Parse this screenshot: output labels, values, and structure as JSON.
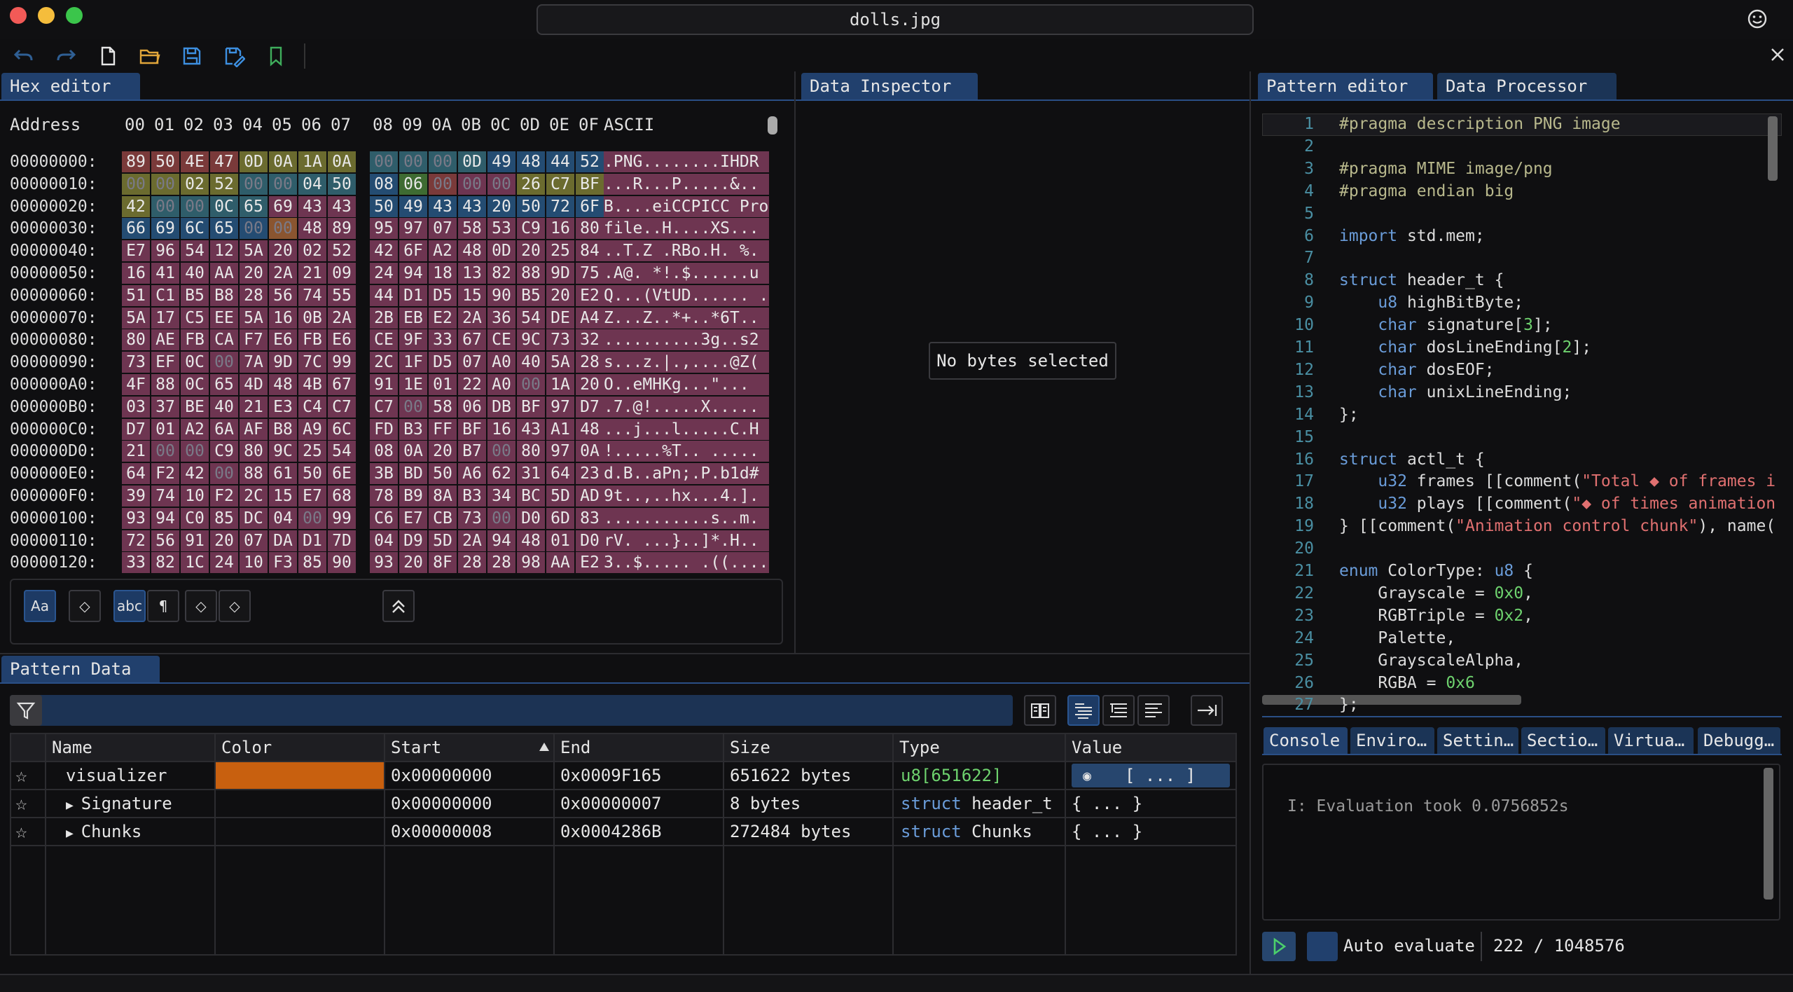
{
  "window": {
    "title": "dolls.jpg",
    "colors": {
      "close": "#f25a57",
      "minimize": "#f5bd3c",
      "zoom": "#3bc54b"
    }
  },
  "toolbar": {
    "icons": [
      "undo-icon",
      "redo-icon",
      "new-file-icon",
      "open-folder-icon",
      "save-icon",
      "save-as-icon",
      "bookmark-icon"
    ]
  },
  "tabs": {
    "hex_editor": "Hex editor",
    "data_inspector": "Data Inspector",
    "pattern_editor": "Pattern editor",
    "data_processor": "Data Processor",
    "pattern_data": "Pattern Data"
  },
  "hex": {
    "address_label": "Address",
    "columns": [
      "00",
      "01",
      "02",
      "03",
      "04",
      "05",
      "06",
      "07",
      "08",
      "09",
      "0A",
      "0B",
      "0C",
      "0D",
      "0E",
      "0F"
    ],
    "ascii_label": "ASCII",
    "rows": [
      {
        "addr": "00000000:",
        "bytes": [
          "89",
          "50",
          "4E",
          "47",
          "0D",
          "0A",
          "1A",
          "0A",
          "00",
          "00",
          "00",
          "0D",
          "49",
          "48",
          "44",
          "52"
        ],
        "colors": [
          "red",
          "red",
          "red",
          "red",
          "olive",
          "olive",
          "olive",
          "olive",
          "teal",
          "teal",
          "teal",
          "teal",
          "blue",
          "blue",
          "blue",
          "blue"
        ],
        "ascii": ".PNG........IHDR"
      },
      {
        "addr": "00000010:",
        "bytes": [
          "00",
          "00",
          "02",
          "52",
          "00",
          "00",
          "04",
          "50",
          "08",
          "06",
          "00",
          "00",
          "00",
          "26",
          "C7",
          "BF"
        ],
        "colors": [
          "olive",
          "olive",
          "olive",
          "olive",
          "teal",
          "teal",
          "teal",
          "teal",
          "blue",
          "green",
          "red",
          "pink",
          "pink",
          "olive",
          "olive",
          "olive"
        ],
        "ascii": "...R...P.....&.."
      },
      {
        "addr": "00000020:",
        "bytes": [
          "42",
          "00",
          "00",
          "0C",
          "65",
          "69",
          "43",
          "43",
          "50",
          "49",
          "43",
          "43",
          "20",
          "50",
          "72",
          "6F"
        ],
        "colors": [
          "olive",
          "teal",
          "teal",
          "teal",
          "teal",
          "pink",
          "pink",
          "pink",
          "blue",
          "blue",
          "blue",
          "blue",
          "blue",
          "blue",
          "blue",
          "blue"
        ],
        "ascii": "B....eiCCPICC Pro"
      },
      {
        "addr": "00000030:",
        "bytes": [
          "66",
          "69",
          "6C",
          "65",
          "00",
          "00",
          "48",
          "89",
          "95",
          "97",
          "07",
          "58",
          "53",
          "C9",
          "16",
          "80"
        ],
        "colors": [
          "blue",
          "blue",
          "blue",
          "blue",
          "blue",
          "orange",
          "pink",
          "pink",
          "pink",
          "pink",
          "pink",
          "pink",
          "pink",
          "pink",
          "pink",
          "pink"
        ],
        "ascii": "file..H....XS..."
      },
      {
        "addr": "00000040:",
        "bytes": [
          "E7",
          "96",
          "54",
          "12",
          "5A",
          "20",
          "02",
          "52",
          "42",
          "6F",
          "A2",
          "48",
          "0D",
          "20",
          "25",
          "84"
        ],
        "ascii": "..T.Z .RBo.H. %."
      },
      {
        "addr": "00000050:",
        "bytes": [
          "16",
          "41",
          "40",
          "AA",
          "20",
          "2A",
          "21",
          "09",
          "24",
          "94",
          "18",
          "13",
          "82",
          "88",
          "9D",
          "75"
        ],
        "ascii": ".A@. *!.$......u"
      },
      {
        "addr": "00000060:",
        "bytes": [
          "51",
          "C1",
          "B5",
          "B8",
          "28",
          "56",
          "74",
          "55",
          "44",
          "D1",
          "D5",
          "15",
          "90",
          "B5",
          "20",
          "E2"
        ],
        "ascii": "Q...(VtUD...... ."
      },
      {
        "addr": "00000070:",
        "bytes": [
          "5A",
          "17",
          "C5",
          "EE",
          "5A",
          "16",
          "0B",
          "2A",
          "2B",
          "EB",
          "E2",
          "2A",
          "36",
          "54",
          "DE",
          "A4"
        ],
        "ascii": "Z...Z..*+..*6T.."
      },
      {
        "addr": "00000080:",
        "bytes": [
          "80",
          "AE",
          "FB",
          "CA",
          "F7",
          "E6",
          "FB",
          "E6",
          "CE",
          "9F",
          "33",
          "67",
          "CE",
          "9C",
          "73",
          "32"
        ],
        "ascii": "..........3g..s2"
      },
      {
        "addr": "00000090:",
        "bytes": [
          "73",
          "EF",
          "0C",
          "00",
          "7A",
          "9D",
          "7C",
          "99",
          "2C",
          "1F",
          "D5",
          "07",
          "A0",
          "40",
          "5A",
          "28"
        ],
        "ascii": "s...z.|.,....@Z("
      },
      {
        "addr": "000000A0:",
        "bytes": [
          "4F",
          "88",
          "0C",
          "65",
          "4D",
          "48",
          "4B",
          "67",
          "91",
          "1E",
          "01",
          "22",
          "A0",
          "00",
          "1A",
          "20"
        ],
        "ascii": "O..eMHKg...\"... "
      },
      {
        "addr": "000000B0:",
        "bytes": [
          "03",
          "37",
          "BE",
          "40",
          "21",
          "E3",
          "C4",
          "C7",
          "C7",
          "00",
          "58",
          "06",
          "DB",
          "BF",
          "97",
          "D7"
        ],
        "ascii": ".7.@!.....X....."
      },
      {
        "addr": "000000C0:",
        "bytes": [
          "D7",
          "01",
          "A2",
          "6A",
          "AF",
          "B8",
          "A9",
          "6C",
          "FD",
          "B3",
          "FF",
          "BF",
          "16",
          "43",
          "A1",
          "48"
        ],
        "ascii": "...j...l.....C.H"
      },
      {
        "addr": "000000D0:",
        "bytes": [
          "21",
          "00",
          "00",
          "C9",
          "80",
          "9C",
          "25",
          "54",
          "08",
          "0A",
          "20",
          "B7",
          "00",
          "80",
          "97",
          "0A"
        ],
        "ascii": "!.....%T.. ....."
      },
      {
        "addr": "000000E0:",
        "bytes": [
          "64",
          "F2",
          "42",
          "00",
          "88",
          "61",
          "50",
          "6E",
          "3B",
          "BD",
          "50",
          "A6",
          "62",
          "31",
          "64",
          "23"
        ],
        "ascii": "d.B..aPn;.P.b1d#"
      },
      {
        "addr": "000000F0:",
        "bytes": [
          "39",
          "74",
          "10",
          "F2",
          "2C",
          "15",
          "E7",
          "68",
          "78",
          "B9",
          "8A",
          "B3",
          "34",
          "BC",
          "5D",
          "AD"
        ],
        "ascii": "9t..,..hx...4.]."
      },
      {
        "addr": "00000100:",
        "bytes": [
          "93",
          "94",
          "C0",
          "85",
          "DC",
          "04",
          "00",
          "99",
          "C6",
          "E7",
          "CB",
          "73",
          "00",
          "D0",
          "6D",
          "83"
        ],
        "ascii": "...........s..m."
      },
      {
        "addr": "00000110:",
        "bytes": [
          "72",
          "56",
          "91",
          "20",
          "07",
          "DA",
          "D1",
          "7D",
          "04",
          "D9",
          "5D",
          "2A",
          "94",
          "48",
          "01",
          "D0"
        ],
        "ascii": "rV. ...}..]*.H.."
      },
      {
        "addr": "00000120:",
        "bytes": [
          "33",
          "82",
          "1C",
          "24",
          "10",
          "F3",
          "85",
          "90",
          "93",
          "20",
          "8F",
          "28",
          "28",
          "98",
          "AA",
          "E2"
        ],
        "ascii": "3..$..... .((...."
      }
    ],
    "footer_buttons": [
      {
        "icon": "font-case-icon",
        "label": "Aa"
      },
      {
        "icon": "lightbulb-icon",
        "label": ""
      },
      {
        "icon": "abc-icon",
        "label": "abc"
      },
      {
        "icon": "pilcrow-icon",
        "label": "¶"
      },
      {
        "icon": "map-icon",
        "label": ""
      },
      {
        "icon": "table-icon",
        "label": ""
      }
    ]
  },
  "inspector": {
    "empty_message": "No bytes selected"
  },
  "pattern_editor": {
    "lines": [
      [
        [
          "pp",
          "#pragma description PNG image"
        ]
      ],
      [],
      [
        [
          "pp",
          "#pragma MIME image/png"
        ]
      ],
      [
        [
          "pp",
          "#pragma endian big"
        ]
      ],
      [],
      [
        [
          "kw",
          "import"
        ],
        [
          "t",
          " std.mem;"
        ]
      ],
      [],
      [
        [
          "kw",
          "struct"
        ],
        [
          "t",
          " header_t {"
        ]
      ],
      [
        [
          "t",
          "    "
        ],
        [
          "kw",
          "u8"
        ],
        [
          "t",
          " highBitByte;"
        ]
      ],
      [
        [
          "t",
          "    "
        ],
        [
          "kw",
          "char"
        ],
        [
          "t",
          " signature["
        ],
        [
          "num",
          "3"
        ],
        [
          "t",
          "];"
        ]
      ],
      [
        [
          "t",
          "    "
        ],
        [
          "kw",
          "char"
        ],
        [
          "t",
          " dosLineEnding["
        ],
        [
          "num",
          "2"
        ],
        [
          "t",
          "];"
        ]
      ],
      [
        [
          "t",
          "    "
        ],
        [
          "kw",
          "char"
        ],
        [
          "t",
          " dosEOF;"
        ]
      ],
      [
        [
          "t",
          "    "
        ],
        [
          "kw",
          "char"
        ],
        [
          "t",
          " unixLineEnding;"
        ]
      ],
      [
        [
          "t",
          "};"
        ]
      ],
      [],
      [
        [
          "kw",
          "struct"
        ],
        [
          "t",
          " actl_t {"
        ]
      ],
      [
        [
          "t",
          "    "
        ],
        [
          "kw",
          "u32"
        ],
        [
          "t",
          " frames [[comment("
        ],
        [
          "str",
          "\"Total ◆ of frames i"
        ]
      ],
      [
        [
          "t",
          "    "
        ],
        [
          "kw",
          "u32"
        ],
        [
          "t",
          " plays [[comment("
        ],
        [
          "str",
          "\"◆ of times animation"
        ]
      ],
      [
        [
          "t",
          "} [[comment("
        ],
        [
          "str",
          "\"Animation control chunk\""
        ],
        [
          "t",
          "), name("
        ]
      ],
      [],
      [
        [
          "kw",
          "enum"
        ],
        [
          "t",
          " ColorType: "
        ],
        [
          "kw",
          "u8"
        ],
        [
          "t",
          " {"
        ]
      ],
      [
        [
          "t",
          "    Grayscale = "
        ],
        [
          "num",
          "0x0"
        ],
        [
          "t",
          ","
        ]
      ],
      [
        [
          "t",
          "    RGBTriple = "
        ],
        [
          "num",
          "0x2"
        ],
        [
          "t",
          ","
        ]
      ],
      [
        [
          "t",
          "    Palette,"
        ]
      ],
      [
        [
          "t",
          "    GrayscaleAlpha,"
        ]
      ],
      [
        [
          "t",
          "    RGBA = "
        ],
        [
          "num",
          "0x6"
        ]
      ],
      [
        [
          "t",
          "};"
        ]
      ]
    ]
  },
  "bottom_tabs": [
    "Console",
    "Enviro…",
    "Settin…",
    "Sectio…",
    "Virtua…",
    "Debugg…"
  ],
  "console": {
    "message": "I: Evaluation took 0.0756852s"
  },
  "auto_evaluate": {
    "label": "Auto evaluate",
    "counter": "222 / 1048576"
  },
  "pattern_data": {
    "columns": [
      "Name",
      "Color",
      "Start",
      "End",
      "Size",
      "Type",
      "Value"
    ],
    "rows": [
      {
        "name": "visualizer",
        "expand": false,
        "color": "#c8600f",
        "start": "0x00000000",
        "end": "0x0009F165",
        "size": "651622 bytes",
        "type_kw": "u8",
        "type_rest": "[651622]",
        "value": "[ ... ]",
        "value_visualizer": true
      },
      {
        "name": "Signature",
        "expand": true,
        "color": "",
        "start": "0x00000000",
        "end": "0x00000007",
        "size": "8 bytes",
        "type_kw": "struct",
        "type_rest": " header_t",
        "value": "{ ... }",
        "value_visualizer": false
      },
      {
        "name": "Chunks",
        "expand": true,
        "color": "",
        "start": "0x00000008",
        "end": "0x0004286B",
        "size": "272484 bytes",
        "type_kw": "struct",
        "type_rest": " Chunks",
        "value": "{ ... }",
        "value_visualizer": false
      }
    ]
  }
}
